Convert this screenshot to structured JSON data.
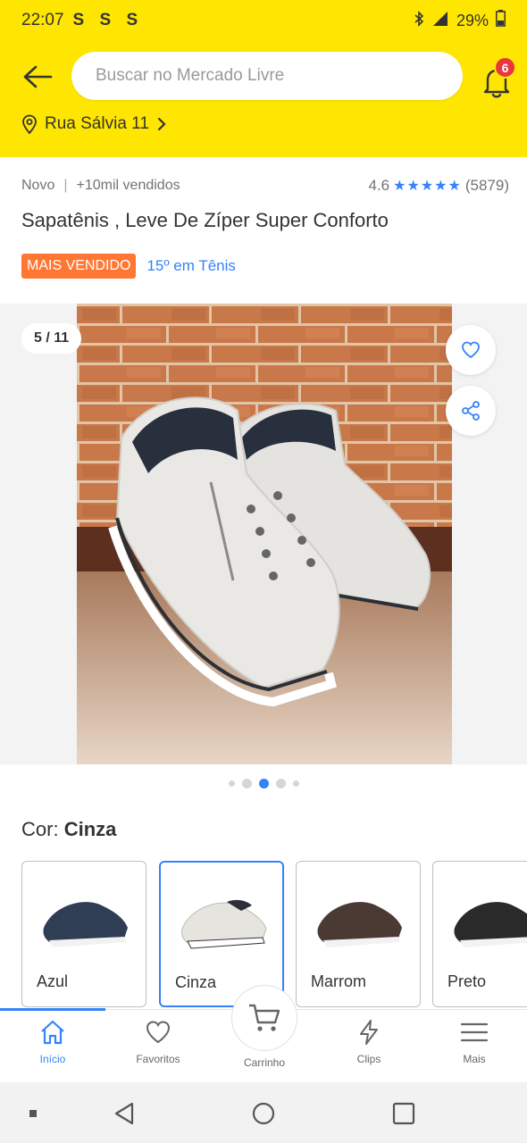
{
  "status_bar": {
    "time": "22:07",
    "notif_icons": "S S S",
    "battery": "29%"
  },
  "header": {
    "search_placeholder": "Buscar no Mercado Livre",
    "notification_count": "6",
    "address": "Rua Sálvia 11"
  },
  "product": {
    "condition": "Novo",
    "sold": "+10mil vendidos",
    "rating": "4.6",
    "stars": "★★★★★",
    "reviews": "(5879)",
    "title": "Sapatênis , Leve De  Zíper Super Conforto",
    "best_seller_badge": "MAIS VENDIDO",
    "rank_link": "15º em Tênis"
  },
  "gallery": {
    "counter": "5 / 11"
  },
  "color_selector": {
    "label": "Cor: ",
    "selected": "Cinza",
    "options": [
      {
        "label": "Azul",
        "color": "#2f3e55"
      },
      {
        "label": "Cinza",
        "color": "#e6e4df"
      },
      {
        "label": "Marrom",
        "color": "#4a3a33"
      },
      {
        "label": "Preto",
        "color": "#2a2a2a"
      }
    ]
  },
  "bottom_nav": {
    "items": [
      {
        "label": "Início"
      },
      {
        "label": "Favoritos"
      },
      {
        "label": "Carrinho"
      },
      {
        "label": "Clips"
      },
      {
        "label": "Mais"
      }
    ]
  },
  "colors": {
    "brand_yellow": "#ffe600",
    "accent_blue": "#3483fa",
    "badge_orange": "#ff7733",
    "notification_red": "#e8363d"
  }
}
